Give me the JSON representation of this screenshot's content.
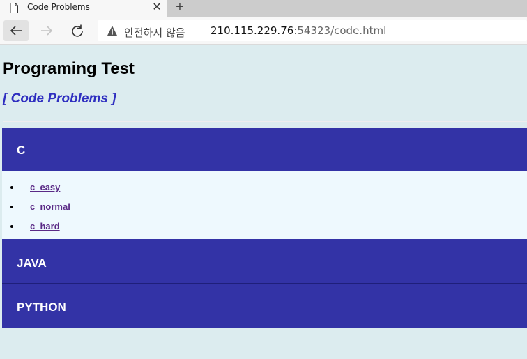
{
  "browser": {
    "tab_title": "Code Problems",
    "close_label": "✕",
    "new_tab_label": "+",
    "security_label": "안전하지 않음",
    "url_host": "210.115.229.76",
    "url_rest": ":54323/code.html"
  },
  "page": {
    "title": "Programing Test",
    "subtitle": "[ Code Problems ]"
  },
  "sections": [
    {
      "label": "C",
      "links": [
        "c_easy",
        "c_normal",
        "c_hard"
      ]
    },
    {
      "label": "JAVA"
    },
    {
      "label": "PYTHON"
    }
  ],
  "colors": {
    "page_bg": "#dcecef",
    "header_bg": "#3333a6",
    "subtitle": "#2f2fc0",
    "link": "#5a2a86",
    "panel_bg": "#eef9fe"
  }
}
